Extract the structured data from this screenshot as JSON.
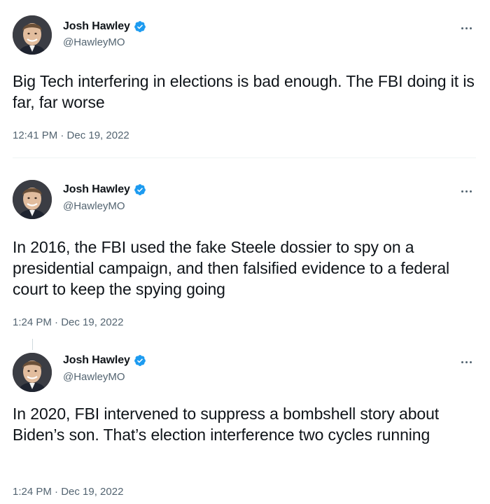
{
  "tweets": [
    {
      "author": {
        "display_name": "Josh Hawley",
        "handle": "@HawleyMO",
        "verified": true,
        "avatar_icon": "profile-photo"
      },
      "text": "Big Tech interfering in elections is bad enough. The FBI doing it is far, far worse",
      "timestamp": "12:41 PM · Dec 19, 2022"
    },
    {
      "author": {
        "display_name": "Josh Hawley",
        "handle": "@HawleyMO",
        "verified": true,
        "avatar_icon": "profile-photo"
      },
      "text": "In 2016, the FBI used the fake Steele dossier to spy on a presidential campaign, and then falsified evidence to a federal court to keep the spying going",
      "timestamp": "1:24 PM · Dec 19, 2022"
    },
    {
      "author": {
        "display_name": "Josh Hawley",
        "handle": "@HawleyMO",
        "verified": true,
        "avatar_icon": "profile-photo"
      },
      "text": "In 2020, FBI intervened to suppress a bombshell story about Biden’s son. That’s election interference two cycles running",
      "timestamp": "1:24 PM · Dec 19, 2022"
    }
  ],
  "colors": {
    "text": "#0f1419",
    "secondary": "#536471",
    "verified_badge": "#1d9bf0",
    "divider": "#eff3f4"
  },
  "icons": {
    "verified": "verified-badge-icon",
    "more": "more-options-icon"
  }
}
